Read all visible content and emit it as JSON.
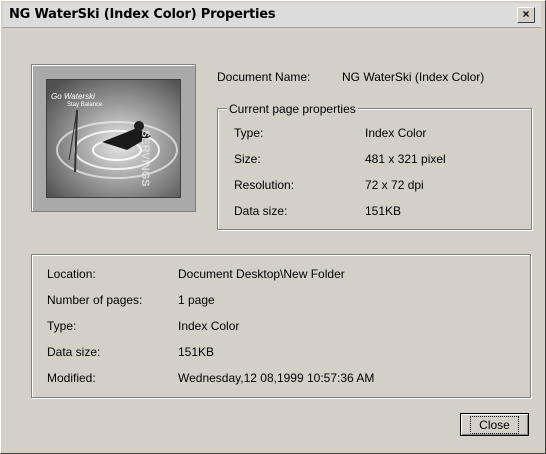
{
  "window": {
    "title": "NG WaterSki (Index Color) Properties",
    "close_glyph": "×"
  },
  "thumbnail": {
    "icon": "waterski-image-thumbnail",
    "text_line1": "Go Waterski",
    "text_line2": "Stay Balance",
    "vertical_text": "SERVINGS"
  },
  "document": {
    "name_label": "Document Name:",
    "name_value": "NG WaterSki (Index Color)"
  },
  "current_page": {
    "group_label": "Current page properties",
    "rows": [
      {
        "label": "Type:",
        "value": "Index Color"
      },
      {
        "label": "Size:",
        "value": "481 x 321 pixel"
      },
      {
        "label": "Resolution:",
        "value": "72 x 72 dpi"
      },
      {
        "label": "Data size:",
        "value": "151KB"
      }
    ]
  },
  "file_info": {
    "rows": [
      {
        "label": "Location:",
        "value": "Document Desktop\\New Folder"
      },
      {
        "label": "Number of pages:",
        "value": "1 page"
      },
      {
        "label": "Type:",
        "value": "Index Color"
      },
      {
        "label": "Data size:",
        "value": "151KB"
      },
      {
        "label": "Modified:",
        "value": "Wednesday,12 08,1999 10:57:36 AM"
      }
    ]
  },
  "buttons": {
    "close_label": "Close"
  }
}
